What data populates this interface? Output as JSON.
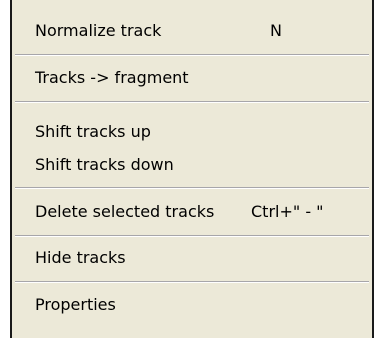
{
  "menu": {
    "items": [
      {
        "label": "Normalize track",
        "shortcut": "N"
      },
      {
        "label": "Tracks -> fragment",
        "shortcut": ""
      },
      {
        "label": "Shift tracks up",
        "shortcut": ""
      },
      {
        "label": "Shift tracks down",
        "shortcut": ""
      },
      {
        "label": "Delete selected tracks",
        "shortcut": "Ctrl+\" - \""
      },
      {
        "label": "Hide tracks",
        "shortcut": ""
      },
      {
        "label": "Properties",
        "shortcut": ""
      }
    ]
  },
  "colors": {
    "menu_background": "#ece9d8",
    "separator_shadow": "#a7a6aa",
    "separator_highlight": "#ffffff",
    "frame": "#1a1a1a"
  }
}
